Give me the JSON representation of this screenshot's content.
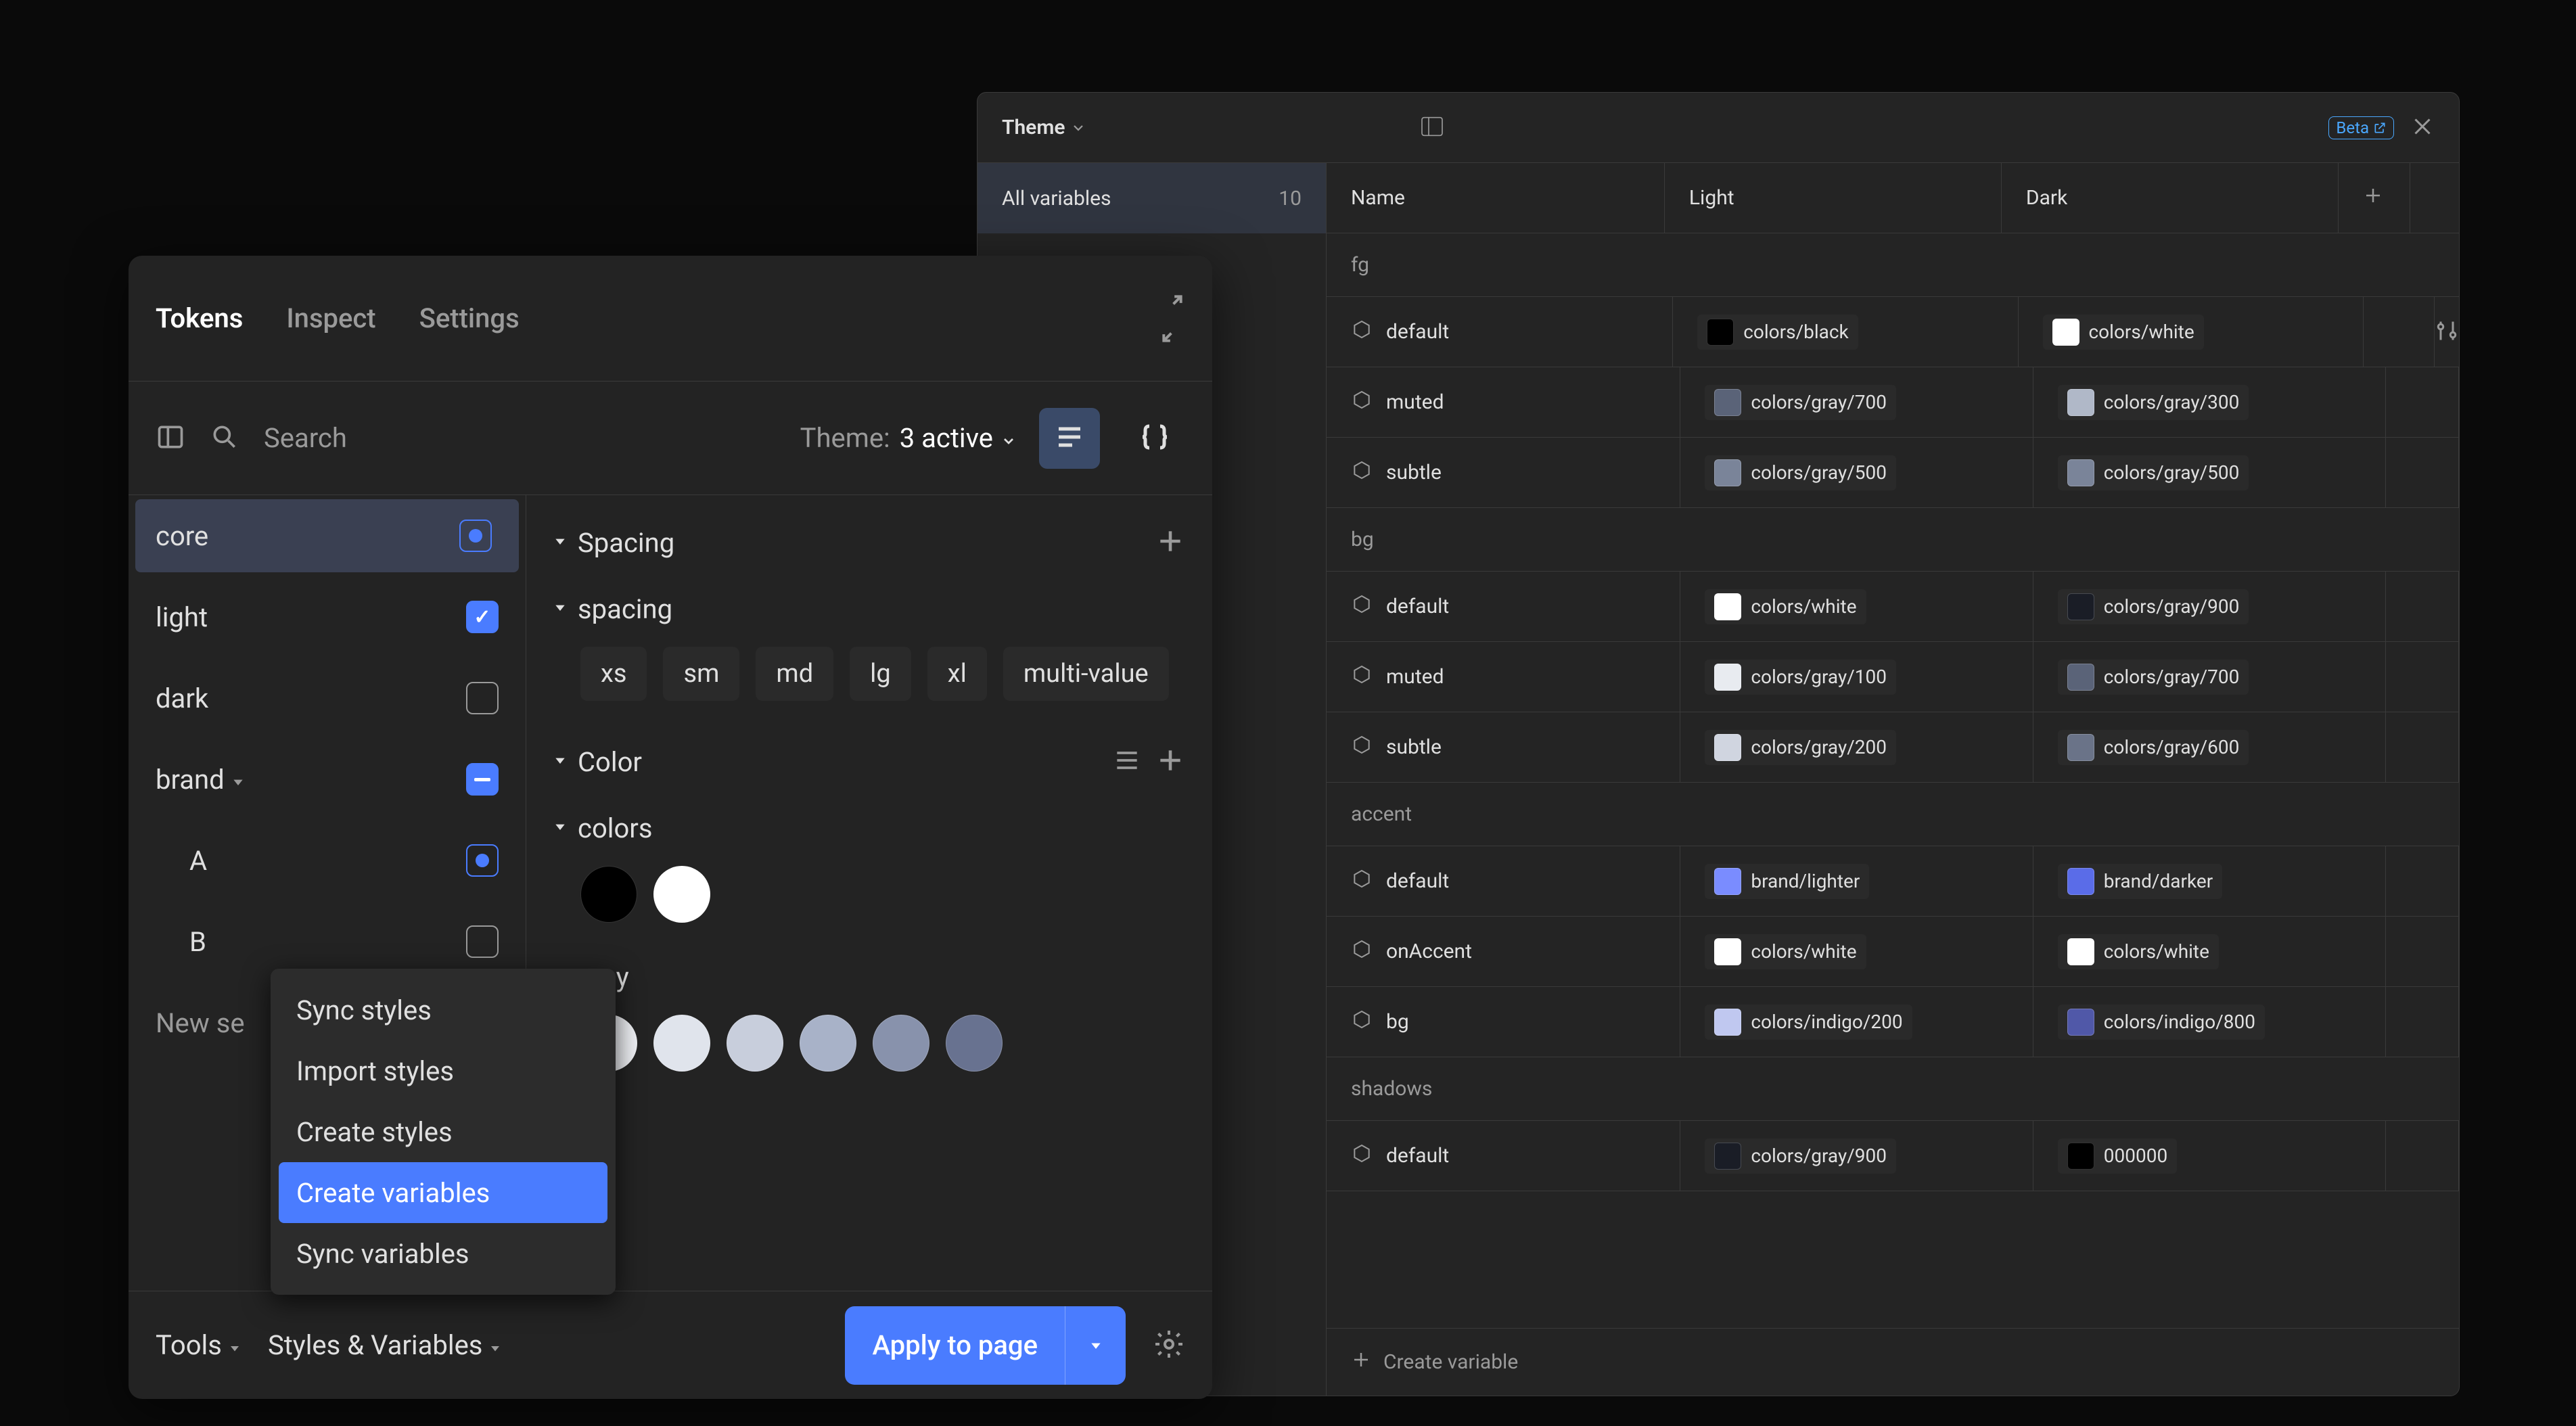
{
  "vars_window": {
    "theme_label": "Theme",
    "beta_label": "Beta",
    "sidebar": {
      "all_label": "All variables",
      "count": "10"
    },
    "columns": {
      "name": "Name",
      "light": "Light",
      "dark": "Dark"
    },
    "groups": [
      {
        "name": "fg",
        "rows": [
          {
            "name": "default",
            "light": {
              "label": "colors/black",
              "color": "#000000"
            },
            "dark": {
              "label": "colors/white",
              "color": "#ffffff"
            },
            "actions": true
          },
          {
            "name": "muted",
            "light": {
              "label": "colors/gray/700",
              "color": "#5a6378"
            },
            "dark": {
              "label": "colors/gray/300",
              "color": "#b0b8c8"
            }
          },
          {
            "name": "subtle",
            "light": {
              "label": "colors/gray/500",
              "color": "#7a8499"
            },
            "dark": {
              "label": "colors/gray/500",
              "color": "#7a8499"
            }
          }
        ]
      },
      {
        "name": "bg",
        "rows": [
          {
            "name": "default",
            "light": {
              "label": "colors/white",
              "color": "#ffffff"
            },
            "dark": {
              "label": "colors/gray/900",
              "color": "#1a1d26"
            }
          },
          {
            "name": "muted",
            "light": {
              "label": "colors/gray/100",
              "color": "#e8ebf0"
            },
            "dark": {
              "label": "colors/gray/700",
              "color": "#5a6378"
            }
          },
          {
            "name": "subtle",
            "light": {
              "label": "colors/gray/200",
              "color": "#d0d5e0"
            },
            "dark": {
              "label": "colors/gray/600",
              "color": "#6a7388"
            }
          }
        ]
      },
      {
        "name": "accent",
        "rows": [
          {
            "name": "default",
            "light": {
              "label": "brand/lighter",
              "color": "#7a8cff"
            },
            "dark": {
              "label": "brand/darker",
              "color": "#5a6ce8"
            }
          },
          {
            "name": "onAccent",
            "light": {
              "label": "colors/white",
              "color": "#ffffff"
            },
            "dark": {
              "label": "colors/white",
              "color": "#ffffff"
            }
          },
          {
            "name": "bg",
            "light": {
              "label": "colors/indigo/200",
              "color": "#c0c8f0"
            },
            "dark": {
              "label": "colors/indigo/800",
              "color": "#5058a8"
            }
          }
        ]
      },
      {
        "name": "shadows",
        "rows": [
          {
            "name": "default",
            "light": {
              "label": "colors/gray/900",
              "color": "#1a1d26"
            },
            "dark": {
              "label": "000000",
              "color": "#000000"
            }
          }
        ]
      }
    ],
    "footer_label": "Create variable"
  },
  "tokens_panel": {
    "tabs": {
      "tokens": "Tokens",
      "inspect": "Inspect",
      "settings": "Settings"
    },
    "search_placeholder": "Search",
    "theme_label": "Theme:",
    "theme_active": "3 active",
    "sets": [
      {
        "name": "core",
        "state": "dot",
        "selected": true
      },
      {
        "name": "light",
        "state": "checked",
        "selected": false
      },
      {
        "name": "dark",
        "state": "empty",
        "selected": false
      },
      {
        "name": "brand",
        "state": "dash",
        "selected": false,
        "expandable": true
      },
      {
        "name": "A",
        "state": "dot",
        "selected": false,
        "indent": true
      },
      {
        "name": "B",
        "state": "empty",
        "selected": false,
        "indent": true
      }
    ],
    "new_set_label": "New se",
    "sections": {
      "spacing": {
        "title": "Spacing",
        "group": "spacing",
        "pills": [
          "xs",
          "sm",
          "md",
          "lg",
          "xl",
          "multi-value"
        ]
      },
      "color": {
        "title": "Color",
        "colors_label": "colors",
        "gray_label": "gray",
        "base_swatches": [
          "#000000",
          "#ffffff"
        ],
        "gray_swatches": [
          "#f0f2f6",
          "#e0e4ec",
          "#c8cedc",
          "#a8b2c8",
          "#8892ac",
          "#687290"
        ]
      }
    },
    "footer": {
      "tools": "Tools",
      "styles": "Styles & Variables",
      "apply": "Apply to page"
    }
  },
  "context_menu": {
    "items": [
      {
        "label": "Sync styles",
        "selected": false
      },
      {
        "label": "Import styles",
        "selected": false
      },
      {
        "label": "Create styles",
        "selected": false
      },
      {
        "label": "Create variables",
        "selected": true
      },
      {
        "label": "Sync variables",
        "selected": false
      }
    ]
  }
}
